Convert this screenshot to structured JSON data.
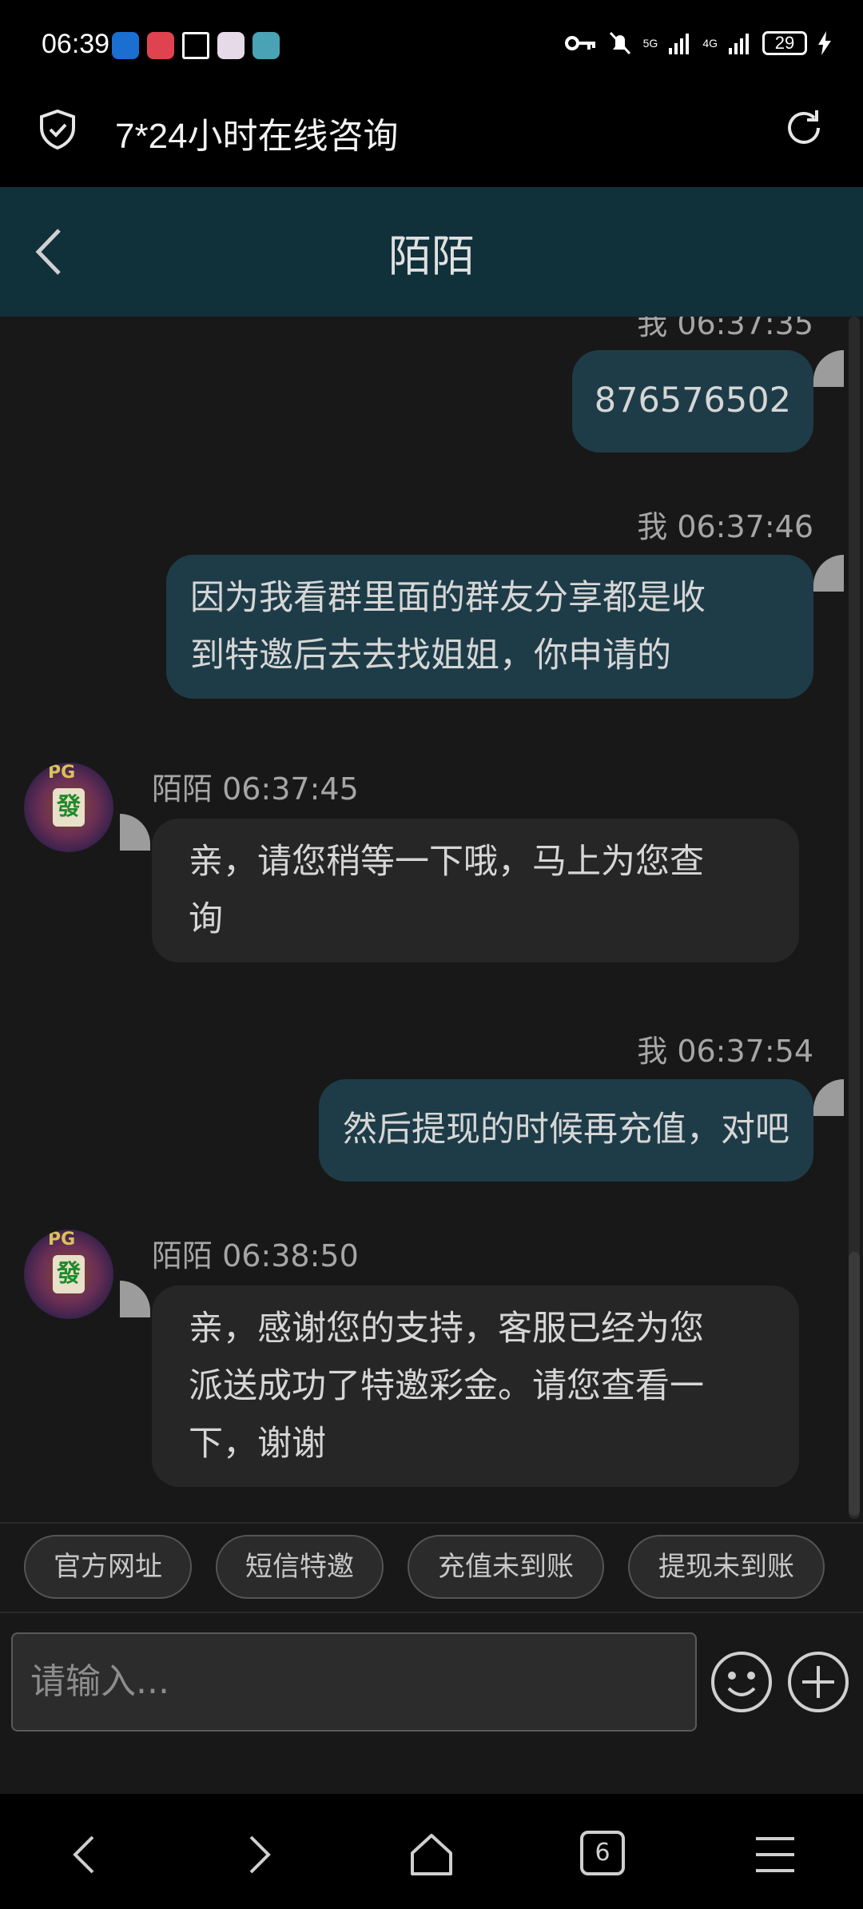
{
  "status_bar": {
    "time": "06:39",
    "network_1": "5G",
    "network_2": "4G",
    "battery": "29"
  },
  "browser": {
    "title": "7*24小时在线咨询"
  },
  "chat": {
    "contact_name": "陌陌",
    "partial_top_meta": "我 06:37:35",
    "messages": [
      {
        "sender": "me",
        "meta": "",
        "text": "876576502"
      },
      {
        "sender": "me",
        "meta": "我 06:37:46",
        "lines": [
          "因为我看群里面的群友分享都是收",
          "到特邀后去去找姐姐，你申请的"
        ]
      },
      {
        "sender": "them",
        "meta": "陌陌 06:37:45",
        "lines": [
          "亲，请您稍等一下哦，马上为您查",
          "询"
        ]
      },
      {
        "sender": "me",
        "meta": "我 06:37:54",
        "text": "然后提现的时候再充值，对吧"
      },
      {
        "sender": "them",
        "meta": "陌陌 06:38:50",
        "lines": [
          "亲，感谢您的支持，客服已经为您",
          "派送成功了特邀彩金。请您查看一",
          "下，谢谢"
        ]
      }
    ],
    "avatar_glyph": "發",
    "avatar_badge": "PG"
  },
  "quick_replies": [
    "官方网址",
    "短信特邀",
    "充值未到账",
    "提现未到账"
  ],
  "composer": {
    "placeholder": "请输入..."
  },
  "navbar": {
    "tab_count": "6"
  },
  "colors": {
    "header_bg": "#10303a",
    "my_bubble": "#1e3c48",
    "their_bubble": "#262626",
    "chat_bg": "#181818"
  }
}
